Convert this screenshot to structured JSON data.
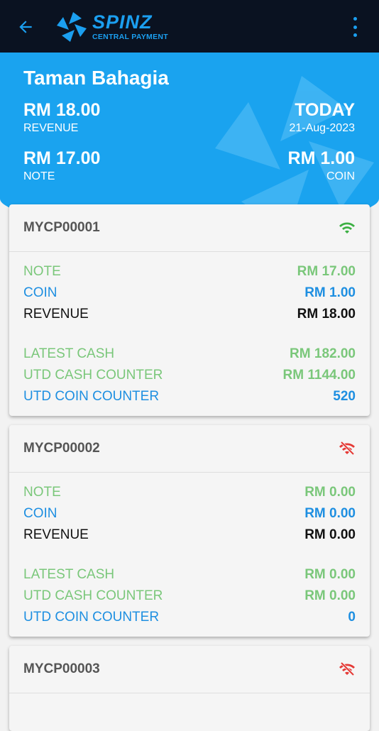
{
  "app": {
    "logo_main": "SPINZ",
    "logo_sub": "CENTRAL PAYMENT"
  },
  "colors": {
    "header_bg": "#0a1221",
    "accent_blue": "#1aa3ef",
    "note_green": "#7ac77a",
    "coin_blue": "#1e8fe1",
    "online_green": "#3cb043",
    "offline_red": "#e53935"
  },
  "summary": {
    "title": "Taman Bahagia",
    "revenue_amount": "RM 18.00",
    "revenue_label": "REVENUE",
    "period_label": "TODAY",
    "date": "21-Aug-2023",
    "note_amount": "RM 17.00",
    "note_label": "NOTE",
    "coin_amount": "RM 1.00",
    "coin_label": "COIN"
  },
  "labels": {
    "note": "NOTE",
    "coin": "COIN",
    "revenue": "REVENUE",
    "latest_cash": "LATEST CASH",
    "utd_cash_counter": "UTD CASH COUNTER",
    "utd_coin_counter": "UTD COIN COUNTER"
  },
  "machines": [
    {
      "id": "MYCP00001",
      "status_icon": "wifi-online-icon",
      "note": "RM 17.00",
      "coin": "RM 1.00",
      "revenue": "RM 18.00",
      "latest_cash": "RM 182.00",
      "utd_cash_counter": "RM 1144.00",
      "utd_coin_counter": "520"
    },
    {
      "id": "MYCP00002",
      "status_icon": "wifi-off-icon",
      "note": "RM 0.00",
      "coin": "RM 0.00",
      "revenue": "RM 0.00",
      "latest_cash": "RM 0.00",
      "utd_cash_counter": "RM 0.00",
      "utd_coin_counter": "0"
    },
    {
      "id": "MYCP00003",
      "status_icon": "wifi-off-icon"
    }
  ]
}
